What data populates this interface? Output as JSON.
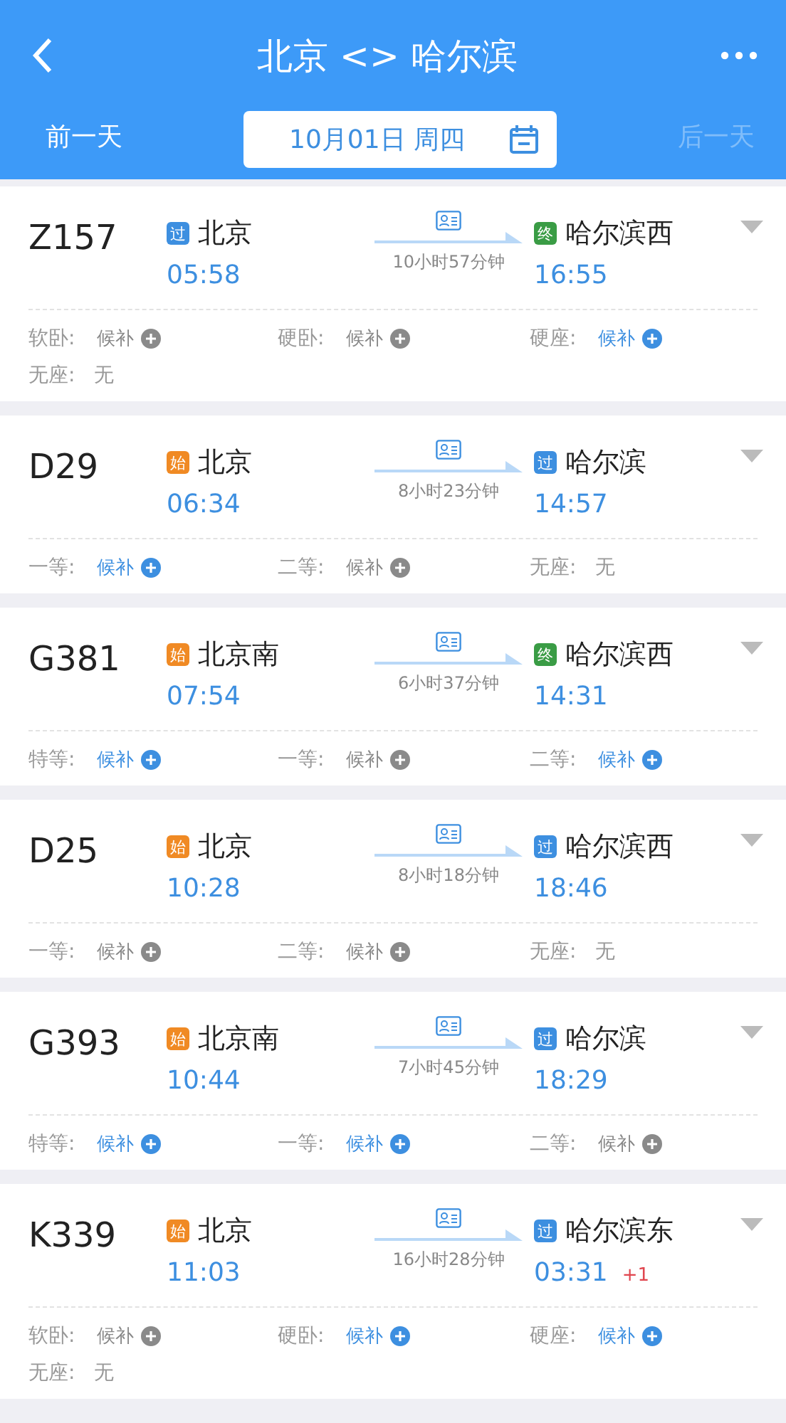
{
  "header": {
    "title": "北京 <> 哈尔滨",
    "prev_day": {
      "label": "前一天",
      "disabled": false
    },
    "date": "10月01日 周四",
    "next_day": {
      "label": "后一天",
      "disabled": true
    }
  },
  "trains": [
    {
      "number": "Z157",
      "from": {
        "badge": {
          "text": "过",
          "color": "#3d8fe0"
        },
        "name": "北京",
        "time": "05:58"
      },
      "duration": "10小时57分钟",
      "to": {
        "badge": {
          "text": "终",
          "color": "#3a9c45"
        },
        "name": "哈尔滨西",
        "time": "16:55"
      },
      "seats": [
        {
          "label": "软卧:",
          "value": "候补",
          "kind": "waitlist",
          "available": false
        },
        {
          "label": "硬卧:",
          "value": "候补",
          "kind": "waitlist",
          "available": false
        },
        {
          "label": "硬座:",
          "value": "候补",
          "kind": "waitlist",
          "available": true
        },
        {
          "label": "无座:",
          "value": "无",
          "kind": "none"
        }
      ]
    },
    {
      "number": "D29",
      "from": {
        "badge": {
          "text": "始",
          "color": "#f08a24"
        },
        "name": "北京",
        "time": "06:34"
      },
      "duration": "8小时23分钟",
      "to": {
        "badge": {
          "text": "过",
          "color": "#3d8fe0"
        },
        "name": "哈尔滨",
        "time": "14:57"
      },
      "seats": [
        {
          "label": "一等:",
          "value": "候补",
          "kind": "waitlist",
          "available": true
        },
        {
          "label": "二等:",
          "value": "候补",
          "kind": "waitlist",
          "available": false
        },
        {
          "label": "无座:",
          "value": "无",
          "kind": "none"
        }
      ]
    },
    {
      "number": "G381",
      "from": {
        "badge": {
          "text": "始",
          "color": "#f08a24"
        },
        "name": "北京南",
        "time": "07:54"
      },
      "duration": "6小时37分钟",
      "to": {
        "badge": {
          "text": "终",
          "color": "#3a9c45"
        },
        "name": "哈尔滨西",
        "time": "14:31"
      },
      "seats": [
        {
          "label": "特等:",
          "value": "候补",
          "kind": "waitlist",
          "available": true
        },
        {
          "label": "一等:",
          "value": "候补",
          "kind": "waitlist",
          "available": false
        },
        {
          "label": "二等:",
          "value": "候补",
          "kind": "waitlist",
          "available": true
        }
      ]
    },
    {
      "number": "D25",
      "from": {
        "badge": {
          "text": "始",
          "color": "#f08a24"
        },
        "name": "北京",
        "time": "10:28"
      },
      "duration": "8小时18分钟",
      "to": {
        "badge": {
          "text": "过",
          "color": "#3d8fe0"
        },
        "name": "哈尔滨西",
        "time": "18:46"
      },
      "seats": [
        {
          "label": "一等:",
          "value": "候补",
          "kind": "waitlist",
          "available": false
        },
        {
          "label": "二等:",
          "value": "候补",
          "kind": "waitlist",
          "available": false
        },
        {
          "label": "无座:",
          "value": "无",
          "kind": "none"
        }
      ]
    },
    {
      "number": "G393",
      "from": {
        "badge": {
          "text": "始",
          "color": "#f08a24"
        },
        "name": "北京南",
        "time": "10:44"
      },
      "duration": "7小时45分钟",
      "to": {
        "badge": {
          "text": "过",
          "color": "#3d8fe0"
        },
        "name": "哈尔滨",
        "time": "18:29"
      },
      "seats": [
        {
          "label": "特等:",
          "value": "候补",
          "kind": "waitlist",
          "available": true
        },
        {
          "label": "一等:",
          "value": "候补",
          "kind": "waitlist",
          "available": true
        },
        {
          "label": "二等:",
          "value": "候补",
          "kind": "waitlist",
          "available": false
        }
      ]
    },
    {
      "number": "K339",
      "from": {
        "badge": {
          "text": "始",
          "color": "#f08a24"
        },
        "name": "北京",
        "time": "11:03"
      },
      "duration": "16小时28分钟",
      "to": {
        "badge": {
          "text": "过",
          "color": "#3d8fe0"
        },
        "name": "哈尔滨东",
        "time": "03:31",
        "day_offset": "+1"
      },
      "seats": [
        {
          "label": "软卧:",
          "value": "候补",
          "kind": "waitlist",
          "available": false
        },
        {
          "label": "硬卧:",
          "value": "候补",
          "kind": "waitlist",
          "available": true
        },
        {
          "label": "硬座:",
          "value": "候补",
          "kind": "waitlist",
          "available": true
        },
        {
          "label": "无座:",
          "value": "无",
          "kind": "none"
        }
      ]
    }
  ]
}
